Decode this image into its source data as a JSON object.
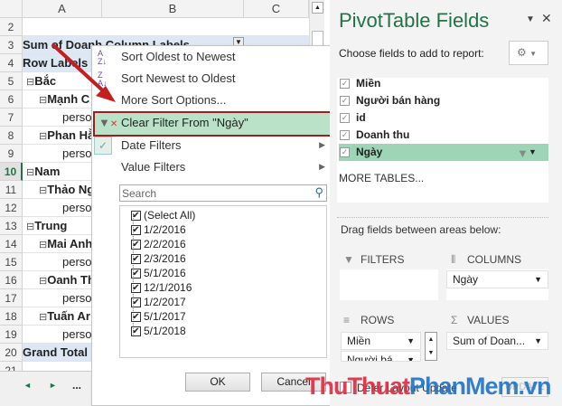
{
  "sheet": {
    "columns": [
      "A",
      "B",
      "C"
    ],
    "row_numbers": [
      "2",
      "3",
      "4",
      "5",
      "6",
      "7",
      "8",
      "9",
      "10",
      "11",
      "12",
      "13",
      "14",
      "15",
      "16",
      "17",
      "18",
      "19",
      "20",
      "21"
    ],
    "cells": [
      "",
      "Sum of Doanh Column Labels",
      "Row Labels",
      "Bắc",
      "Mạnh C",
      "perso",
      "Phan Hằ",
      "perso",
      "Nam",
      "Thảo Ng",
      "perso",
      "Trung",
      "Mai Anh",
      "perso",
      "Oanh Th",
      "perso",
      "Tuấn Ar",
      "perso",
      "Grand Total",
      ""
    ],
    "tab_nav": [
      "◄",
      "►",
      "..."
    ]
  },
  "menu": {
    "items": [
      "Sort Oldest to Newest",
      "Sort Newest to Oldest",
      "More Sort Options...",
      "Clear Filter From \"Ngày\"",
      "Date Filters",
      "Value Filters"
    ],
    "search_placeholder": "Search",
    "list": [
      "(Select All)",
      "1/2/2016",
      "2/2/2016",
      "2/3/2016",
      "5/1/2016",
      "12/1/2016",
      "1/2/2017",
      "5/1/2017",
      "5/1/2018"
    ],
    "ok": "OK",
    "cancel": "Cancel"
  },
  "pane": {
    "title": "PivotTable Fields",
    "choose": "Choose fields to add to report:",
    "fields": [
      "Miền",
      "Người bán hàng",
      "id",
      "Doanh thu",
      "Ngày"
    ],
    "more_tables": "MORE TABLES...",
    "drag": "Drag fields between areas below:",
    "filters": "FILTERS",
    "columns": "COLUMNS",
    "rows": "ROWS",
    "values": "VALUES",
    "columns_items": [
      "Ngày"
    ],
    "rows_items": [
      "Miền",
      "Người bá"
    ],
    "values_items": [
      "Sum of Doan..."
    ],
    "defer": "Defer Layout Update",
    "update": "UPDATE"
  },
  "watermark": {
    "part1": "ThuThuat",
    "part2": "PhanMem.vn"
  },
  "colors": {
    "highlight": "#9fd5b7",
    "annotation": "#b11a1a"
  }
}
